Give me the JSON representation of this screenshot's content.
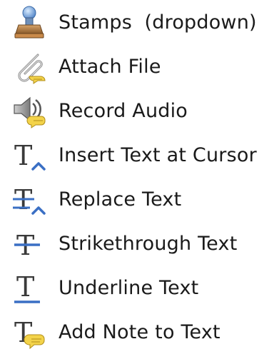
{
  "menu": {
    "items": [
      {
        "label": "Stamps  (dropdown)",
        "icon": "stamp-icon"
      },
      {
        "label": "Attach File",
        "icon": "paperclip-note-icon"
      },
      {
        "label": "Record Audio",
        "icon": "speaker-note-icon"
      },
      {
        "label": "Insert Text at Cursor",
        "icon": "insert-text-icon"
      },
      {
        "label": "Replace Text",
        "icon": "replace-text-icon"
      },
      {
        "label": "Strikethrough Text",
        "icon": "strikethrough-text-icon"
      },
      {
        "label": "Underline Text",
        "icon": "underline-text-icon"
      },
      {
        "label": "Add Note to Text",
        "icon": "note-text-icon"
      }
    ]
  },
  "colors": {
    "text": "#1a1a1a",
    "icon_blue": "#3a6fc4",
    "note_yellow": "#f3d34a",
    "stamp_brown": "#9a6b3a",
    "glyph_gray": "#3a3a3a"
  }
}
